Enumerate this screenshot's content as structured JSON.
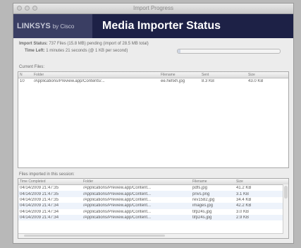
{
  "window": {
    "title": "Import Progress"
  },
  "banner": {
    "brand": "LINKSYS",
    "brand_by": "by Cisco",
    "title": "Media Importer Status"
  },
  "status": {
    "import_status_label": "Import Status:",
    "import_status_value": "737 Files (15.8 MB) pending (import of 28.5 MB total)",
    "time_left_label": "Time Left:",
    "time_left_value": "1 minutes 21 seconds (@ 1 KB per second)",
    "progress": 0.03
  },
  "current_files": {
    "label": "Current Files:",
    "columns": [
      "N",
      "Folder",
      "Filename",
      "Sent",
      "Size"
    ],
    "rows": [
      {
        "n": "10",
        "folder": "/Applications/Preview.app/Contents/...",
        "filename": "ee.hefixh.jpg",
        "sent": "8.3 KB",
        "size": "43.0 KB"
      }
    ]
  },
  "files_imported": {
    "label": "Files imported in this session:",
    "columns": [
      "Time Completed",
      "Folder",
      "Filename",
      "Size"
    ],
    "rows": [
      {
        "time": "04/14/2009 21:47:35",
        "folder": "/Applications/Preview.app/Content...",
        "filename": "pdfs.jpg",
        "size": "41.2 KB"
      },
      {
        "time": "04/14/2009 21:47:35",
        "folder": "/Applications/Preview.app/Content...",
        "filename": "privs.png",
        "size": "3.1 KB"
      },
      {
        "time": "04/14/2009 21:47:35",
        "folder": "/Applications/Preview.app/Content...",
        "filename": "rev1582.jpg",
        "size": "34.4 KB"
      },
      {
        "time": "04/14/2009 21:47:34",
        "folder": "/Applications/Preview.app/Content...",
        "filename": "images.jpg",
        "size": "42.2 KB"
      },
      {
        "time": "04/14/2009 21:47:34",
        "folder": "/Applications/Preview.app/Content...",
        "filename": "tifp24s.jpg",
        "size": "3.0 KB"
      },
      {
        "time": "04/14/2009 21:47:34",
        "folder": "/Applications/Preview.app/Content...",
        "filename": "tifp24s.jpg",
        "size": "2.9 KB"
      }
    ]
  }
}
